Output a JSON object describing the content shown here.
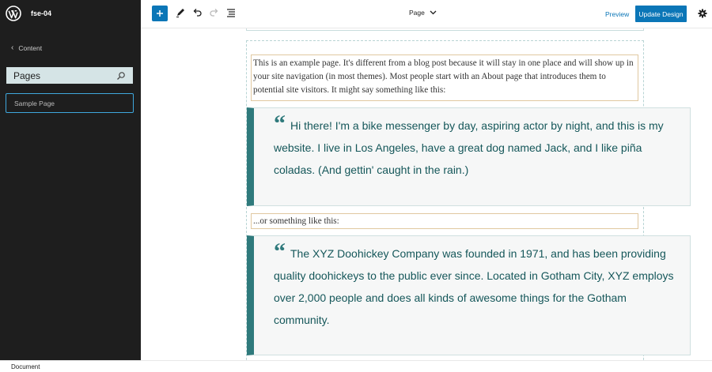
{
  "sidebar": {
    "site_name": "fse-04",
    "back_label": "Content",
    "section_title": "Pages",
    "items": [
      {
        "label": "Sample Page"
      }
    ]
  },
  "topbar": {
    "page_selector_label": "Page",
    "preview_label": "Preview",
    "update_label": "Update Design"
  },
  "content": {
    "paragraph1": "This is an example page. It's different from a blog post because it will stay in one place and will show up in your site navigation (in most themes). Most people start with an About page that introduces them to potential site visitors. It might say something like this:",
    "quote1": "Hi there! I'm a bike messenger by day, aspiring actor by night, and this is my website. I live in Los Angeles, have a great dog named Jack, and I like piña coladas. (And gettin' caught in the rain.)",
    "paragraph2": "...or something like this:",
    "quote2": "The XYZ Doohickey Company was founded in 1971, and has been providing quality doohickeys to the public ever since. Located in Gotham City, XYZ employs over 2,000 people and does all kinds of awesome things for the Gotham community.",
    "quote_mark": "“"
  },
  "footer": {
    "breadcrumb": "Document"
  },
  "colors": {
    "accent": "#0b76b7",
    "quote_border": "#2f7a7c",
    "quote_text": "#15575a",
    "sidebar_bg": "#1e1e1e"
  }
}
